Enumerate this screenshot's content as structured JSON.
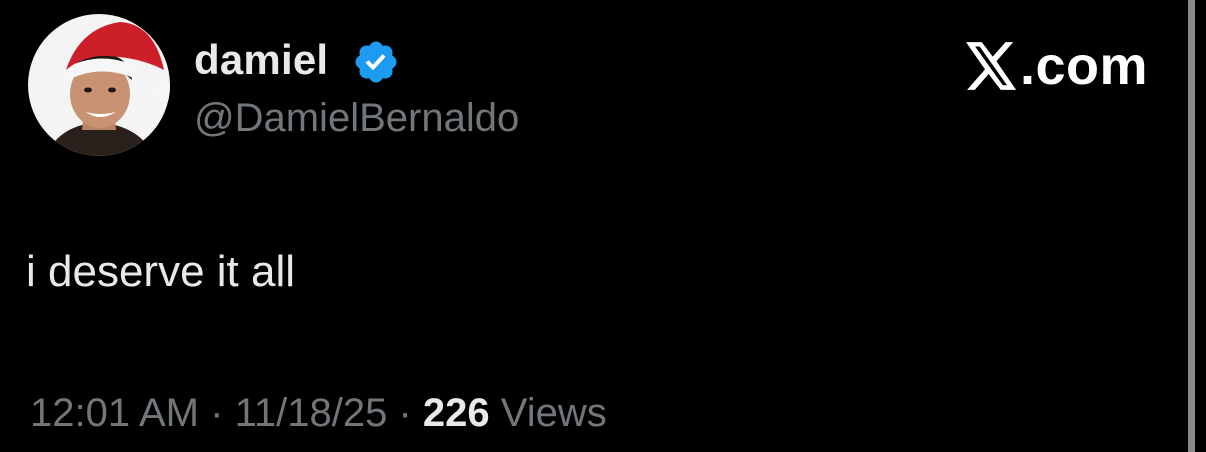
{
  "tweet": {
    "author": {
      "display_name": "damiel",
      "handle": "@DamielBernaldo",
      "verified": true,
      "verified_color": "#1d9bf0",
      "avatar": "profile-photo-santa-hat"
    },
    "brand": {
      "label": ".com",
      "icon": "x-logo-icon"
    },
    "text": "i deserve it all",
    "meta": {
      "time": "12:01 AM",
      "separator": "·",
      "date": "11/18/25",
      "views_count": "226",
      "views_label": "Views"
    }
  },
  "colors": {
    "background": "#000000",
    "primary_text": "#e7e9ea",
    "secondary_text": "#71767b"
  }
}
